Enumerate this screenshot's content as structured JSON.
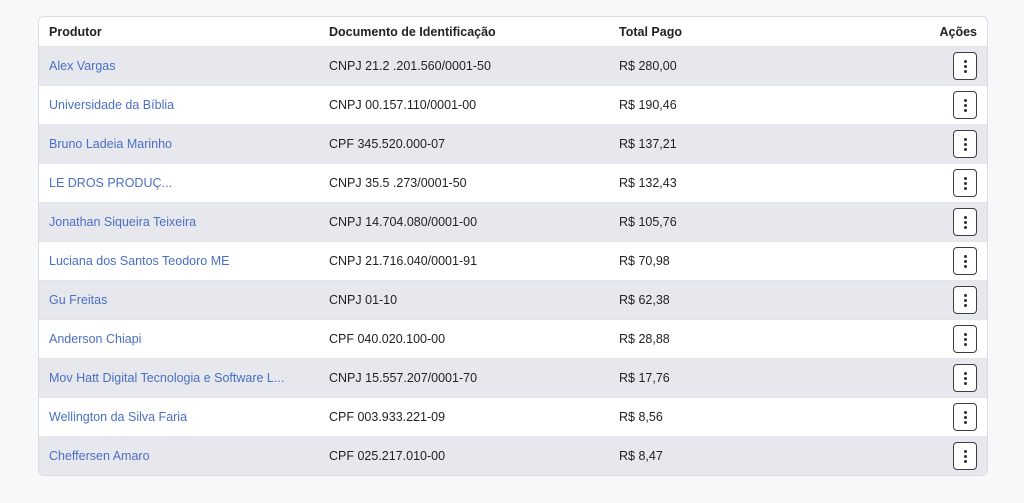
{
  "table": {
    "headers": {
      "producer": "Produtor",
      "document": "Documento de Identificação",
      "total": "Total Pago",
      "actions": "Ações"
    },
    "rows": [
      {
        "producer": "Alex Vargas",
        "document": "CNPJ 21.2 .201.560/0001-50",
        "total": "R$ 280,00"
      },
      {
        "producer": "Universidade da Bíblia",
        "document": "CNPJ 00.157.110/0001-00",
        "total": "R$ 190,46"
      },
      {
        "producer": "Bruno Ladeia Marinho",
        "document": "CPF 345.520.000-07",
        "total": "R$ 137,21"
      },
      {
        "producer": "LE DROS PRODUÇ...",
        "document": "CNPJ 35.5 .273/0001-50",
        "total": "R$ 132,43"
      },
      {
        "producer": "Jonathan Siqueira Teixeira",
        "document": "CNPJ 14.704.080/0001-00",
        "total": "R$ 105,76"
      },
      {
        "producer": "Luciana dos Santos Teodoro ME",
        "document": "CNPJ 21.716.040/0001-91",
        "total": "R$ 70,98"
      },
      {
        "producer": "Gu Freitas",
        "document": "CNPJ 01-10",
        "total": "R$ 62,38"
      },
      {
        "producer": "Anderson Chiapi",
        "document": "CPF 040.020.100-00",
        "total": "R$ 28,88"
      },
      {
        "producer": "Mov Hatt Digital Tecnologia e Software L...",
        "document": "CNPJ 15.557.207/0001-70",
        "total": "R$ 17,76"
      },
      {
        "producer": "Wellington da Silva Faria",
        "document": "CPF 003.933.221-09",
        "total": "R$ 8,56"
      },
      {
        "producer": "Cheffersen Amaro",
        "document": "CPF 025.217.010-00",
        "total": "R$ 8,47"
      }
    ]
  },
  "icons": {
    "action": "kebab-vertical-icon"
  },
  "colors": {
    "link": "#4a6fc4",
    "stripe": "#e6e8ed",
    "border": "#d9dce1"
  }
}
